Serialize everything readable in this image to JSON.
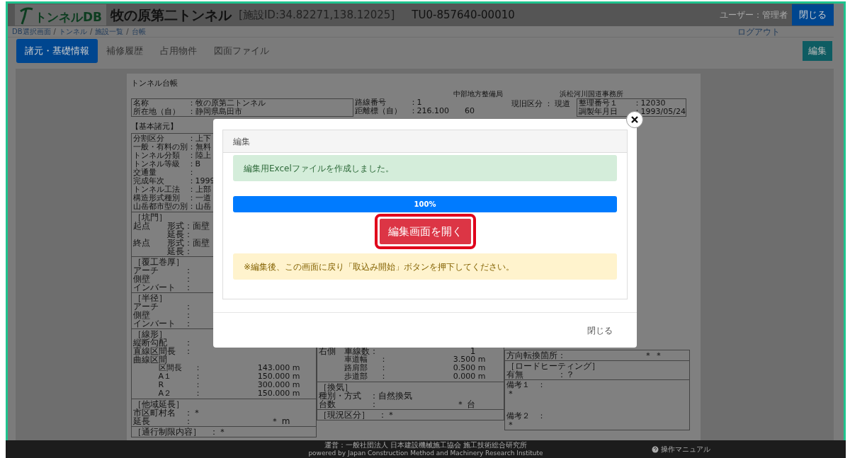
{
  "header": {
    "logo_text": "トンネルDB",
    "title": "牧の原第二トンネル",
    "facility_id": "[施設ID:34.82271,138.12025]",
    "code": "TU0-857640-00010",
    "user": "ユーザー：管理者",
    "close_button": "閉じる",
    "logout": "ログアウト"
  },
  "breadcrumbs": [
    "DB選択画面",
    "トンネル",
    "施設一覧",
    "台帳"
  ],
  "breadcrumb_separator": "/",
  "tabs": [
    {
      "label": "諸元・基礎情報",
      "selected": true
    },
    {
      "label": "補修履歴",
      "selected": false
    },
    {
      "label": "占用物件",
      "selected": false
    },
    {
      "label": "図面ファイル",
      "selected": false
    }
  ],
  "edit_button": "編集",
  "document": {
    "title": "トンネル台帳",
    "office": "中部地方整備局",
    "branch": "浜松河川国道事務所",
    "info_left": [
      [
        "名称",
        "：牧の原第二トンネル"
      ],
      [
        "所在地（自）",
        "：静岡県島田市"
      ]
    ],
    "info_middle": [
      [
        "路線番号",
        "：1"
      ],
      [
        "距離標（自）",
        "：216.100　　60"
      ]
    ],
    "status": "現旧区分 ： 現道",
    "info_right": [
      [
        "整理番号１",
        "：12030"
      ],
      [
        "調製年月日",
        "：1993/05/24"
      ]
    ],
    "section_label": "【基本諸元】",
    "left_column": [
      {
        "kind": "box",
        "lines": [
          {
            "kind": "row",
            "cells": [
              "分割区分",
              "：上下"
            ]
          },
          {
            "kind": "row",
            "cells": [
              "一般・有料の別",
              "：無料"
            ]
          },
          {
            "kind": "row",
            "cells": [
              "トンネル分類",
              "：陸上"
            ]
          },
          {
            "kind": "row",
            "cells": [
              "トンネル等級",
              "：B"
            ]
          },
          {
            "kind": "row",
            "cells": [
              "交通量",
              "："
            ]
          },
          {
            "kind": "row",
            "cells": [
              "完成年次",
              "：1999"
            ]
          },
          {
            "kind": "row",
            "cells": [
              "トンネル工法",
              "：上部"
            ]
          },
          {
            "kind": "row",
            "cells": [
              "構造形式種別",
              "：一道"
            ]
          },
          {
            "kind": "row",
            "cells": [
              "山岳都市型の別",
              "：山岳"
            ]
          }
        ]
      },
      {
        "kind": "box",
        "lines": [
          {
            "kind": "heading",
            "cells": [
              "［坑門］"
            ]
          },
          {
            "kind": "sub",
            "cells": [
              "起点　　形式",
              "：面壁"
            ]
          },
          {
            "kind": "sub",
            "cells": [
              "　　　　延長",
              "："
            ]
          },
          {
            "kind": "sub",
            "cells": [
              "終点　　形式",
              "：面壁"
            ]
          },
          {
            "kind": "sub",
            "cells": [
              "　　　　延長",
              "："
            ]
          }
        ]
      },
      {
        "kind": "box",
        "lines": [
          {
            "kind": "heading",
            "cells": [
              "［覆工巻厚］"
            ]
          },
          {
            "kind": "sub",
            "cells": [
              "アーチ",
              "："
            ]
          },
          {
            "kind": "sub",
            "cells": [
              "側壁",
              "："
            ]
          },
          {
            "kind": "sub",
            "cells": [
              "インバート",
              "："
            ]
          }
        ]
      },
      {
        "kind": "box",
        "lines": [
          {
            "kind": "heading",
            "cells": [
              "［半径］"
            ]
          },
          {
            "kind": "sub",
            "cells": [
              "アーチ",
              "："
            ]
          },
          {
            "kind": "sub",
            "cells": [
              "側壁",
              "："
            ]
          },
          {
            "kind": "sub",
            "cells": [
              "インバート",
              "："
            ]
          }
        ]
      },
      {
        "kind": "box",
        "lines": [
          {
            "kind": "heading",
            "cells": [
              "［線形］"
            ]
          },
          {
            "kind": "sub",
            "cells": [
              "縦断勾配",
              "："
            ]
          },
          {
            "kind": "sub",
            "cells": [
              "直線区間長",
              "："
            ]
          },
          {
            "kind": "sub",
            "cells": [
              "曲線区間"
            ]
          },
          {
            "kind": "deep",
            "cells": [
              "区間長",
              "：",
              "143.000 m"
            ]
          },
          {
            "kind": "deep",
            "cells": [
              "A１",
              "：",
              "150.000 m"
            ]
          },
          {
            "kind": "deep",
            "cells": [
              "R",
              "：",
              "300.000 m"
            ]
          },
          {
            "kind": "deep",
            "cells": [
              "A２",
              "：",
              "150.000 m"
            ]
          }
        ]
      },
      {
        "kind": "box",
        "lines": [
          {
            "kind": "heading",
            "cells": [
              "［他域延長］"
            ]
          },
          {
            "kind": "sub",
            "cells": [
              "市区町村名",
              "：＊"
            ]
          },
          {
            "kind": "sub",
            "cells": [
              "延長",
              "：",
              "＊ m"
            ]
          }
        ]
      },
      {
        "kind": "box",
        "lines": [
          {
            "kind": "heading",
            "cells": [
              "［通行制限内容］",
              "：＊"
            ]
          }
        ]
      }
    ],
    "middle_column": [
      {
        "kind": "box",
        "lines": [
          {
            "kind": "sub",
            "cells": [
              "右側　車線数",
              "：",
              "1"
            ]
          },
          {
            "kind": "deep",
            "cells": [
              "車道幅",
              "：",
              "3.500 m"
            ]
          },
          {
            "kind": "deep",
            "cells": [
              "路肩部",
              "：",
              "0.500 m"
            ]
          },
          {
            "kind": "deep",
            "cells": [
              "歩道部",
              "：",
              "0.000 m"
            ]
          }
        ]
      },
      {
        "kind": "box",
        "lines": [
          {
            "kind": "heading",
            "cells": [
              "［換気］"
            ]
          },
          {
            "kind": "sub",
            "cells": [
              "種別・方式",
              "：自然換気"
            ]
          },
          {
            "kind": "sub",
            "cells": [
              "台数",
              "：",
              "＊ 台"
            ]
          }
        ]
      },
      {
        "kind": "box",
        "lines": [
          {
            "kind": "heading",
            "cells": [
              "［現況区分］",
              "：＊"
            ]
          }
        ]
      }
    ],
    "right_column": [
      {
        "kind": "box",
        "lines": [
          {
            "kind": "sub",
            "cells": [
              "方向転換箇所",
              "：",
              "＊ ＊"
            ]
          }
        ]
      },
      {
        "kind": "box",
        "lines": [
          {
            "kind": "heading",
            "cells": [
              "［ロードヒーティング］"
            ]
          },
          {
            "kind": "sub",
            "cells": [
              "有無",
              "：？"
            ]
          }
        ]
      },
      {
        "kind": "box",
        "lines": [
          {
            "kind": "row",
            "cells": [
              "備考１　："
            ]
          },
          {
            "kind": "sub",
            "cells": [
              "＊"
            ]
          },
          {
            "kind": "gap",
            "cells": [
              "備考２　："
            ]
          },
          {
            "kind": "sub",
            "cells": [
              "＊"
            ]
          }
        ]
      }
    ]
  },
  "modal": {
    "title": "編集",
    "success": "編集用Excelファイルを作成しました。",
    "progress": {
      "level": 1,
      "label": "100%"
    },
    "open_button": "編集画面を開く",
    "highlighted": true,
    "warning": "※編集後、この画面に戻り「取込み開始」ボタンを押下してください。",
    "close_button": "閉じる"
  },
  "footer": {
    "operator": "運営：一般社団法人 日本建設機械施工協会 施工技術総合研究所",
    "powered": "powered by Japan Construction Method and Machinery Research Institute",
    "manual": "操作マニュアル"
  }
}
